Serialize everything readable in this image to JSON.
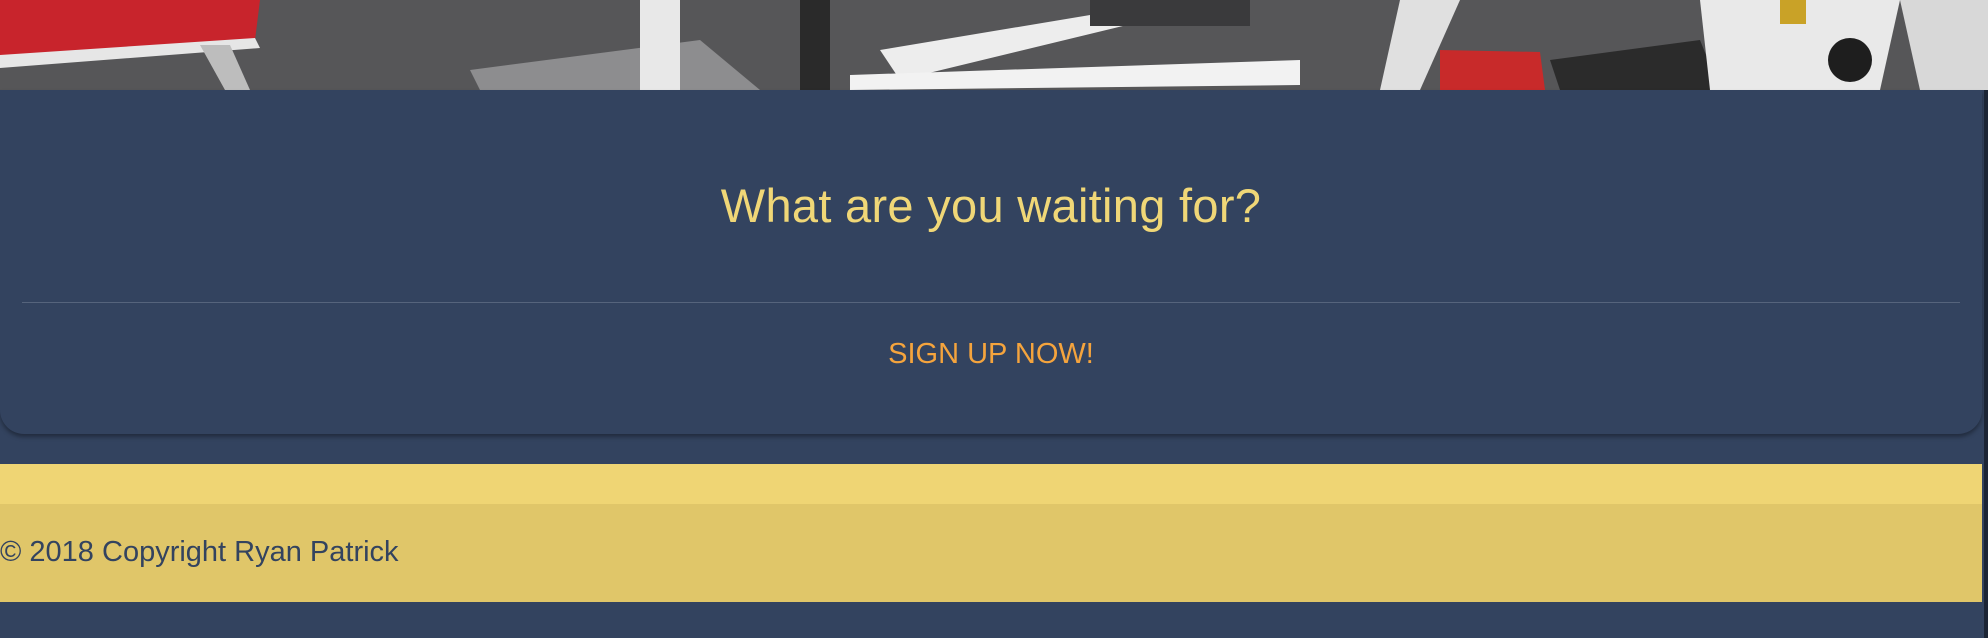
{
  "cta": {
    "heading": "What are you waiting for?",
    "signup_label": "SIGN UP NOW!"
  },
  "footer": {
    "copyright": "© 2018 Copyright Ryan Patrick"
  },
  "colors": {
    "background": "#33435f",
    "heading": "#f0d777",
    "signup": "#f5a43d",
    "footer_band": "#efd574",
    "footer": "#e0c669"
  }
}
